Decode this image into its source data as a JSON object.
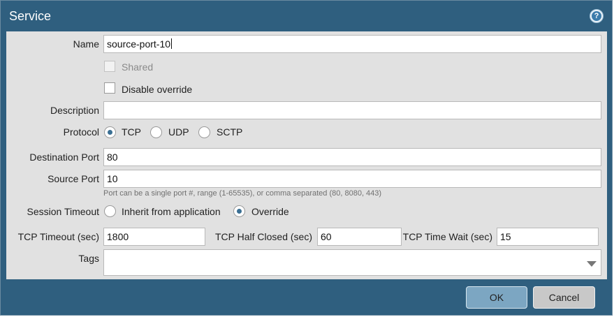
{
  "dialog": {
    "title": "Service",
    "help_icon": "question-circle-icon",
    "help_glyph": "?"
  },
  "name": {
    "label": "Name",
    "value": "source-port-10"
  },
  "shared": {
    "label": "Shared",
    "checked": false,
    "disabled": true
  },
  "disable_override": {
    "label": "Disable override",
    "checked": false
  },
  "description": {
    "label": "Description",
    "value": ""
  },
  "protocol": {
    "label": "Protocol",
    "options": [
      "TCP",
      "UDP",
      "SCTP"
    ],
    "selected": "TCP"
  },
  "destination_port": {
    "label": "Destination Port",
    "value": "80"
  },
  "source_port": {
    "label": "Source Port",
    "value": "10",
    "hint": "Port can be a single port #, range (1-65535), or comma separated (80, 8080, 443)"
  },
  "session_timeout": {
    "label": "Session Timeout",
    "options": [
      "Inherit from application",
      "Override"
    ],
    "selected": "Override"
  },
  "tcp_timeout": {
    "label": "TCP Timeout (sec)",
    "value": "1800"
  },
  "tcp_half_closed": {
    "label": "TCP Half Closed (sec)",
    "value": "60"
  },
  "tcp_time_wait": {
    "label": "TCP Time Wait (sec)",
    "value": "15"
  },
  "tags": {
    "label": "Tags",
    "value": "",
    "dropdown_icon": "caret-down-icon"
  },
  "buttons": {
    "ok": "OK",
    "cancel": "Cancel"
  },
  "colors": {
    "frame": "#2f5f7f",
    "body": "#e1e1e1",
    "ok_button": "#7ca6c2",
    "cancel_button": "#c8c8c8",
    "radio_dot": "#3a6f93"
  }
}
